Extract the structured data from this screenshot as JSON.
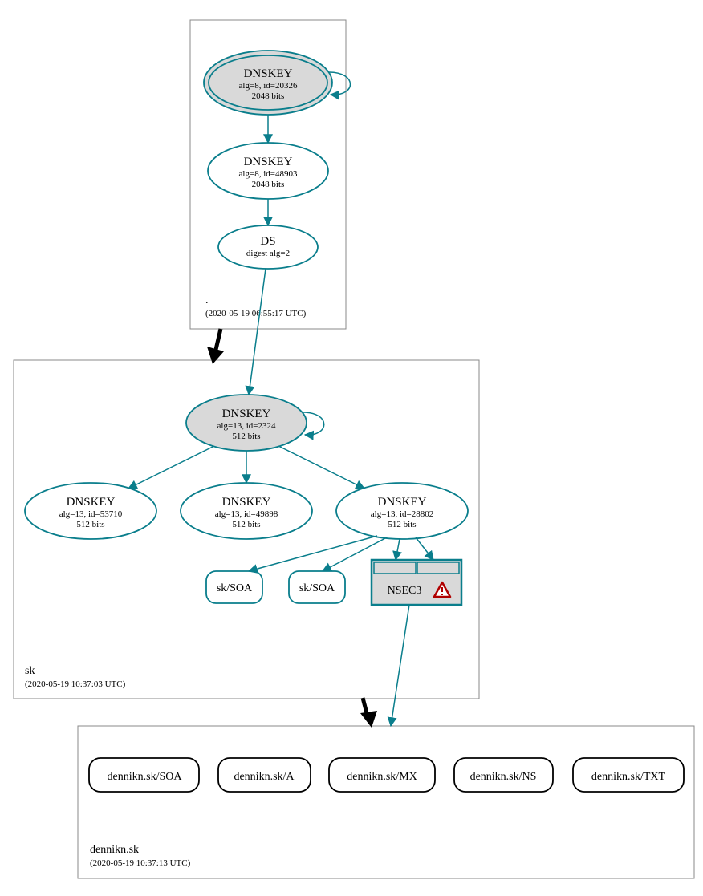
{
  "colors": {
    "stroke": "#0a7e8c",
    "node_grey": "#d9d9d9"
  },
  "zones": {
    "root": {
      "label": ".",
      "timestamp": "(2020-05-19 06:55:17 UTC)"
    },
    "sk": {
      "label": "sk",
      "timestamp": "(2020-05-19 10:37:03 UTC)"
    },
    "domain": {
      "label": "dennikn.sk",
      "timestamp": "(2020-05-19 10:37:13 UTC)"
    }
  },
  "root": {
    "ksk": {
      "title": "DNSKEY",
      "line1": "alg=8, id=20326",
      "line2": "2048 bits"
    },
    "zsk": {
      "title": "DNSKEY",
      "line1": "alg=8, id=48903",
      "line2": "2048 bits"
    },
    "ds": {
      "title": "DS",
      "line1": "digest alg=2"
    }
  },
  "sk": {
    "ksk": {
      "title": "DNSKEY",
      "line1": "alg=13, id=2324",
      "line2": "512 bits"
    },
    "k1": {
      "title": "DNSKEY",
      "line1": "alg=13, id=53710",
      "line2": "512 bits"
    },
    "k2": {
      "title": "DNSKEY",
      "line1": "alg=13, id=49898",
      "line2": "512 bits"
    },
    "k3": {
      "title": "DNSKEY",
      "line1": "alg=13, id=28802",
      "line2": "512 bits"
    },
    "soa1": "sk/SOA",
    "soa2": "sk/SOA",
    "nsec": "NSEC3"
  },
  "domain": {
    "r0": "dennikn.sk/SOA",
    "r1": "dennikn.sk/A",
    "r2": "dennikn.sk/MX",
    "r3": "dennikn.sk/NS",
    "r4": "dennikn.sk/TXT"
  },
  "icons": {
    "warning": "warning-triangle"
  }
}
